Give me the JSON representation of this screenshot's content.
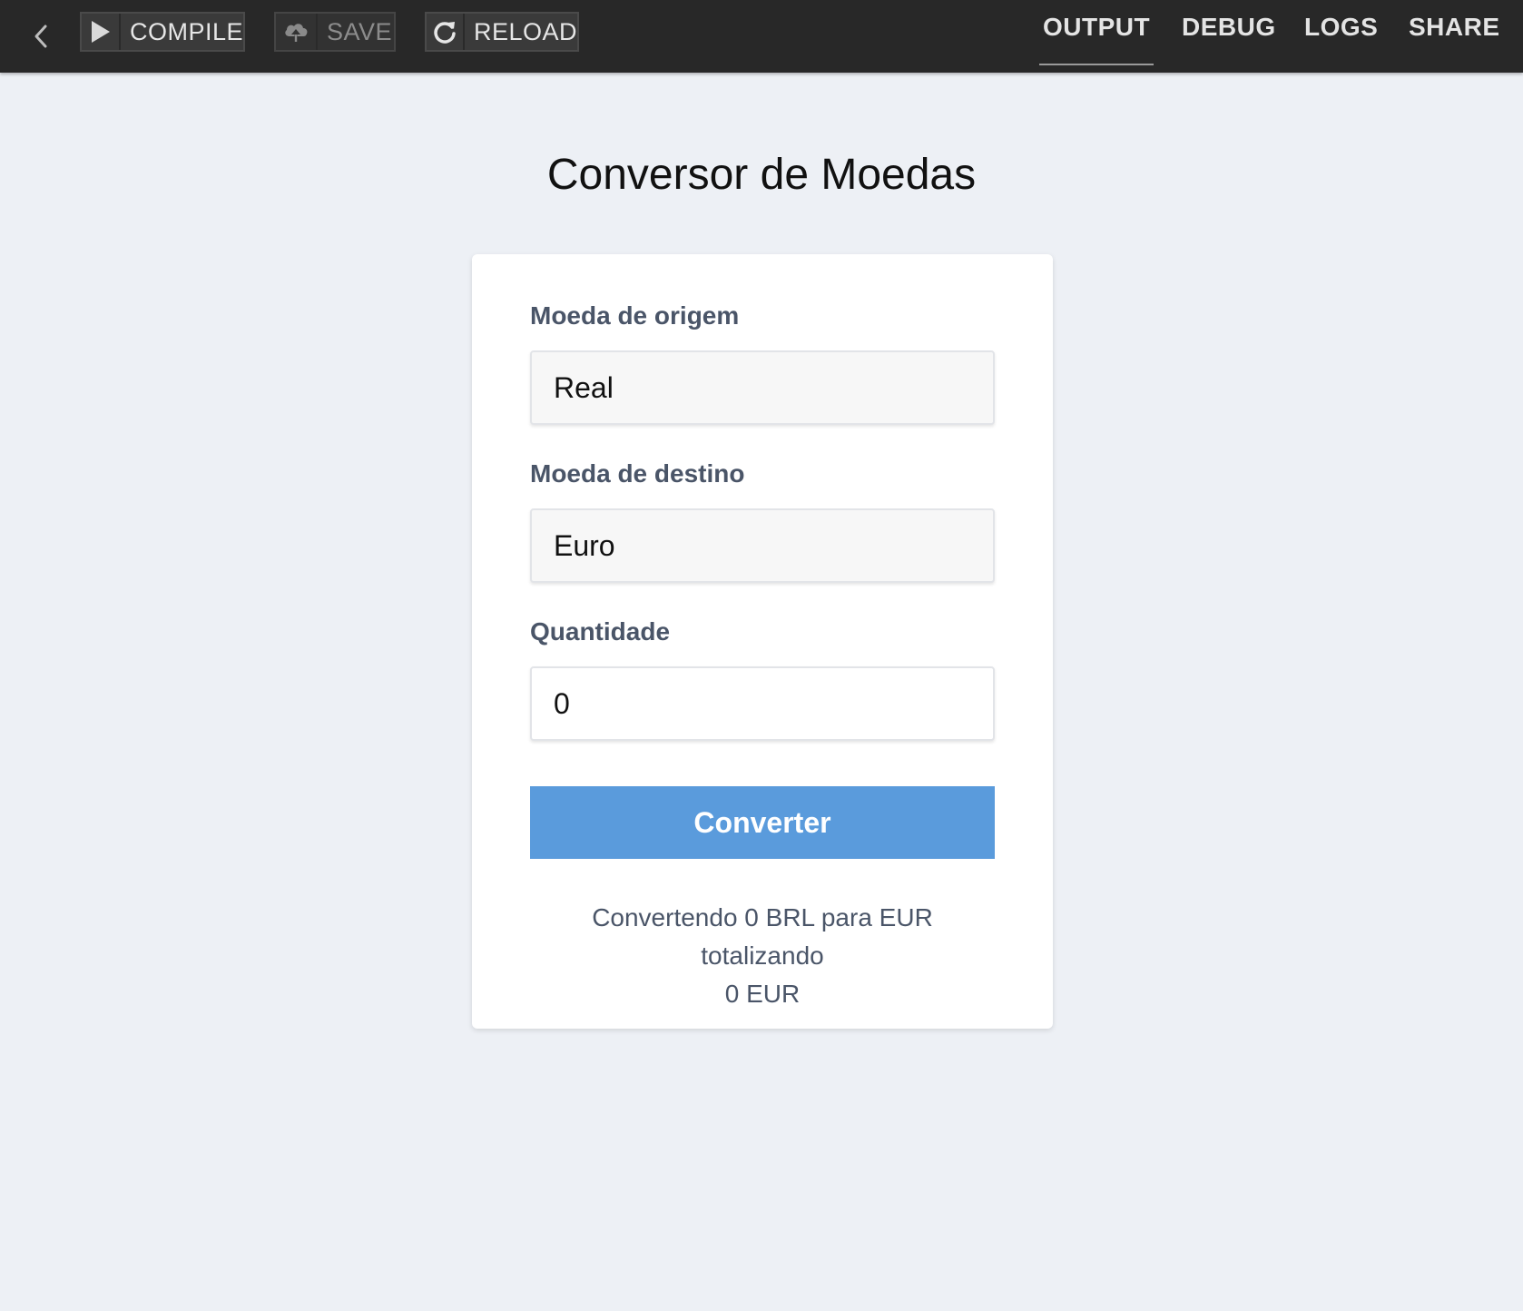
{
  "toolbar": {
    "back_icon": "chevron-left-icon",
    "compile": {
      "label": "COMPILE",
      "icon": "play-icon"
    },
    "save": {
      "label": "SAVE",
      "icon": "cloud-upload-icon"
    },
    "reload": {
      "label": "RELOAD",
      "icon": "refresh-icon"
    },
    "tabs": [
      {
        "label": "OUTPUT",
        "active": true
      },
      {
        "label": "DEBUG",
        "active": false
      },
      {
        "label": "LOGS",
        "active": false
      },
      {
        "label": "SHARE",
        "active": false
      }
    ]
  },
  "main": {
    "title": "Conversor de Moedas",
    "source_currency": {
      "label": "Moeda de origem",
      "value": "Real"
    },
    "target_currency": {
      "label": "Moeda de destino",
      "value": "Euro"
    },
    "amount": {
      "label": "Quantidade",
      "value": "0"
    },
    "convert_button": "Converter",
    "result_line1": "Convertendo 0 BRL para EUR totalizando",
    "result_line2": "0 EUR"
  },
  "colors": {
    "toolbar_bg": "#282828",
    "page_bg": "#edf0f5",
    "accent": "#5a9bdc",
    "label_text": "#4a5568"
  }
}
